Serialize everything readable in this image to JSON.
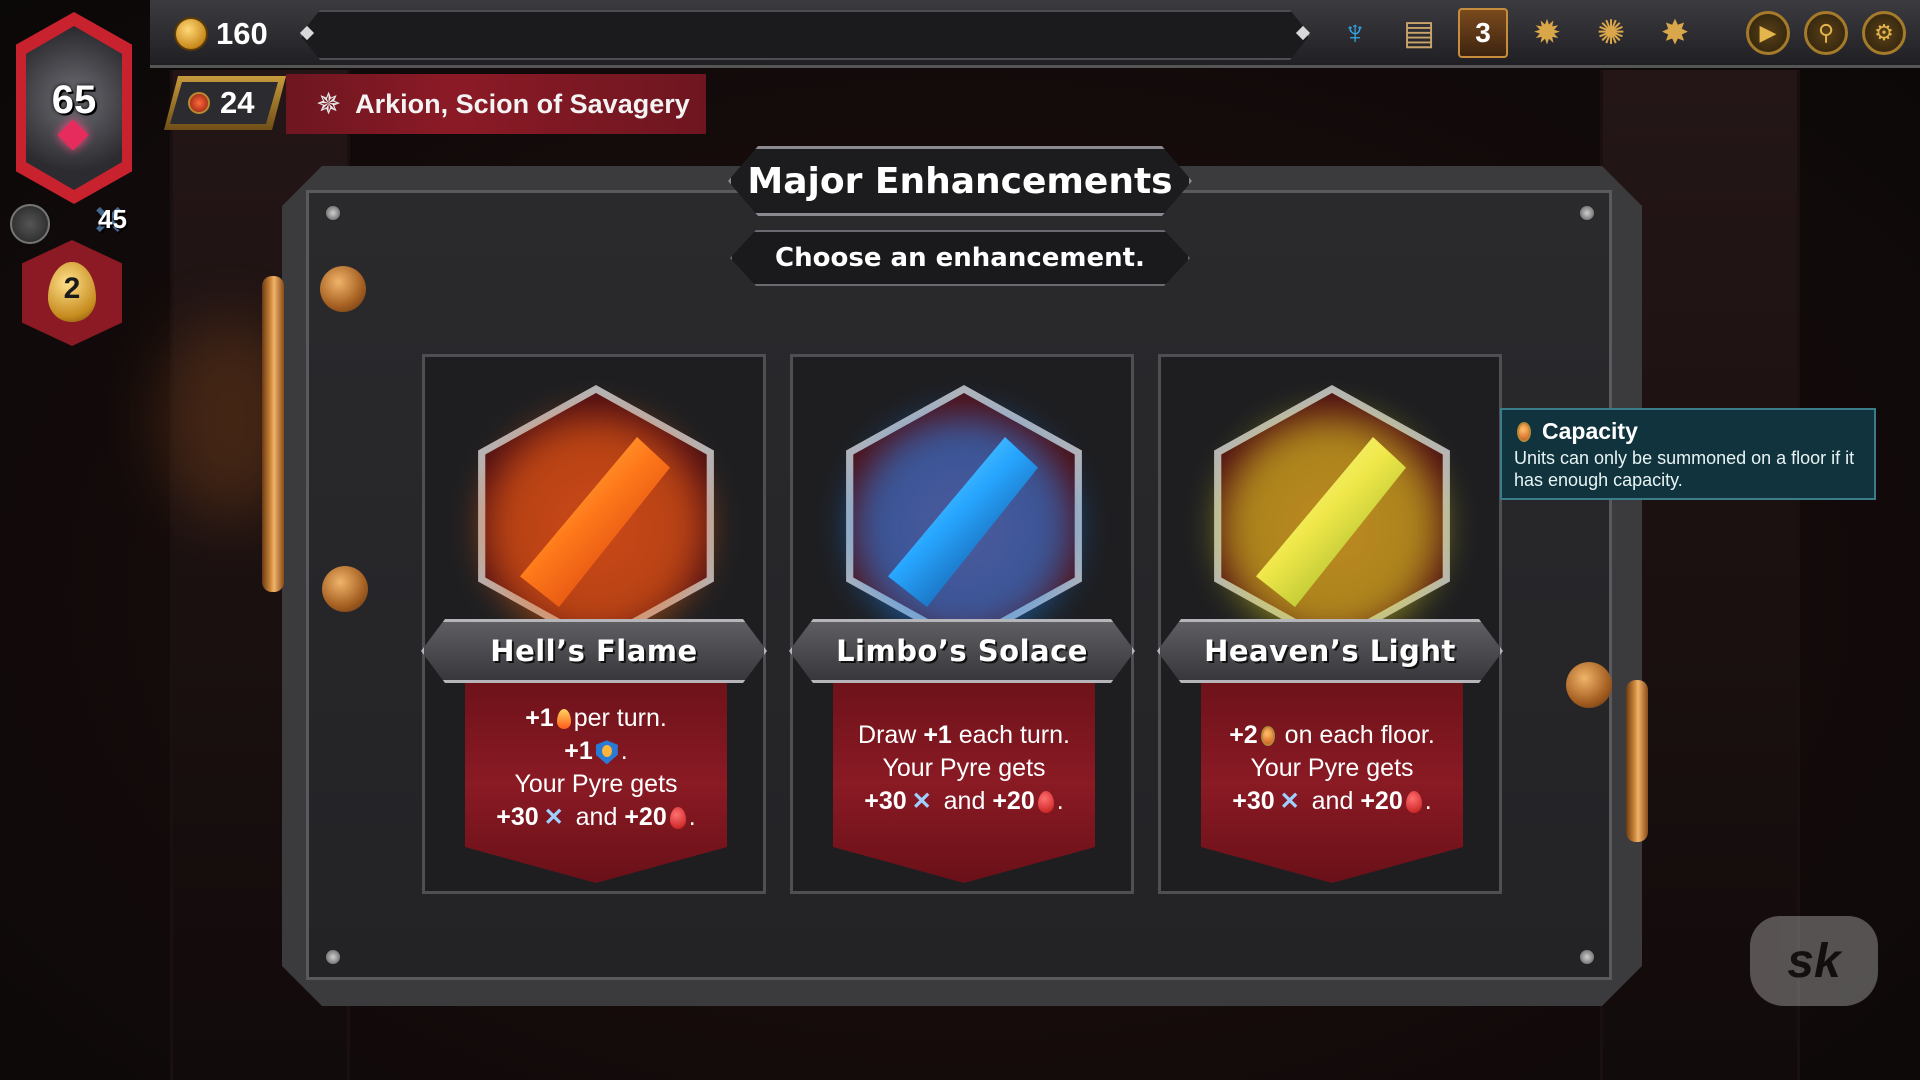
{
  "resources": {
    "gold": "160",
    "pyre_health": "65",
    "pyre_attack": "45",
    "dragon_eggs": "2",
    "ember": "24"
  },
  "boss": {
    "name": "Arkion, Scion of Savagery",
    "icon": "boss-crest-icon"
  },
  "top_icons": [
    {
      "name": "covenant-icon"
    },
    {
      "name": "logbook-icon"
    },
    {
      "name": "chapter-icon",
      "value": "3"
    },
    {
      "name": "boss-sigil-1-icon"
    },
    {
      "name": "boss-sigil-2-icon"
    },
    {
      "name": "boss-sigil-3-icon"
    }
  ],
  "controls": {
    "play_icon": "play-icon",
    "map_icon": "map-icon",
    "settings_icon": "gear-icon"
  },
  "dialog": {
    "title": "Major Enhancements",
    "subtitle": "Choose an enhancement."
  },
  "cards": [
    {
      "name": "Hell’s Flame",
      "color": "#ff7a1a",
      "line1_value": "+1",
      "line1_suffix": "per turn.",
      "line2_value": "+1",
      "pyre_text": "Your Pyre gets",
      "attack": "+30",
      "and": "and",
      "health": "+20"
    },
    {
      "name": "Limbo’s Solace",
      "color": "#27a6ff",
      "line1_prefix": "Draw",
      "line1_value": "+1",
      "line1_suffix": "each turn.",
      "pyre_text": "Your Pyre gets",
      "attack": "+30",
      "and": "and",
      "health": "+20"
    },
    {
      "name": "Heaven’s Light",
      "color": "#f0e84a",
      "line1_value": "+2",
      "line1_suffix": "on each floor.",
      "pyre_text": "Your Pyre gets",
      "attack": "+30",
      "and": "and",
      "health": "+20"
    }
  ],
  "tooltip": {
    "title": "Capacity",
    "body": "Units can only be summoned on a floor if it has enough capacity."
  },
  "watermark": "sk"
}
